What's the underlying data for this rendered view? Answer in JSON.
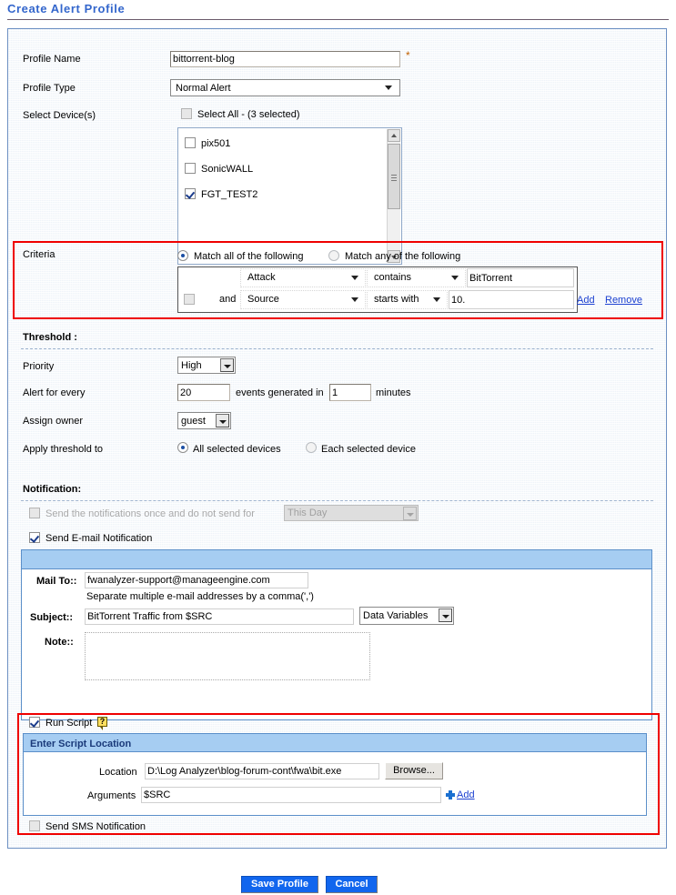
{
  "page": {
    "title": "Create Alert Profile"
  },
  "form": {
    "profile_name": {
      "label": "Profile Name",
      "value": "bittorrent-blog",
      "required_mark": "*"
    },
    "profile_type": {
      "label": "Profile Type",
      "value": "Normal Alert"
    },
    "select_devices": {
      "label": "Select Device(s)",
      "select_all_label": "Select All - (3 selected)",
      "select_all_checked": false,
      "devices": [
        {
          "name": "pix501",
          "checked": false
        },
        {
          "name": "SonicWALL",
          "checked": false
        },
        {
          "name": "FGT_TEST2",
          "checked": true
        }
      ]
    }
  },
  "criteria": {
    "label": "Criteria",
    "match_all_label": "Match all of the following",
    "match_any_label": "Match any of the following",
    "match_selected": "all",
    "rows": [
      {
        "joiner": "",
        "field": "Attack",
        "operator": "contains",
        "value": "BitTorrent",
        "checked": false
      },
      {
        "joiner": "and",
        "field": "Source",
        "operator": "starts with",
        "value": "10.",
        "checked": false
      }
    ],
    "add_label": "Add",
    "remove_label": "Remove"
  },
  "threshold": {
    "section_label": "Threshold :",
    "priority": {
      "label": "Priority",
      "value": "High"
    },
    "alert_for_every": {
      "label": "Alert for every",
      "events_value": "20",
      "middle_text": "events generated in",
      "minutes_value": "1",
      "unit_text": "minutes"
    },
    "assign_owner": {
      "label": "Assign owner",
      "value": "guest"
    },
    "apply_threshold_to": {
      "label": "Apply threshold to",
      "option_all": "All selected devices",
      "option_each": "Each selected device",
      "selected": "all"
    }
  },
  "notification": {
    "section_label": "Notification:",
    "send_once": {
      "label": "Send the notifications once and do not send for",
      "checked": false,
      "disabled": true,
      "period_value": "This Day"
    },
    "send_email": {
      "label": "Send E-mail Notification",
      "checked": true
    },
    "email": {
      "mail_to_label": "Mail To::",
      "mail_to_value": "fwanalyzer-support@manageengine.com",
      "mail_to_hint": "Separate multiple e-mail addresses by a comma(',')",
      "subject_label": "Subject::",
      "subject_value": "BitTorrent Traffic from $SRC",
      "data_variables_label": "Data Variables",
      "note_label": "Note::",
      "note_value": ""
    },
    "run_script": {
      "label": "Run Script",
      "checked": true,
      "help_icon_text": "?",
      "panel_title": "Enter Script Location",
      "location_label": "Location",
      "location_value": "D:\\Log Analyzer\\blog-forum-cont\\fwa\\bit.exe",
      "browse_label": "Browse...",
      "arguments_label": "Arguments",
      "arguments_value": "$SRC",
      "add_label": "Add"
    },
    "send_sms": {
      "label": "Send SMS Notification",
      "checked": false
    }
  },
  "footer": {
    "save_label": "Save Profile",
    "cancel_label": "Cancel"
  },
  "colors": {
    "title": "#3366cc",
    "highlight_border": "#ef0000",
    "section_bar": "#a6cdf2",
    "link": "#1a3fd0",
    "primary_button": "#1166ee"
  }
}
